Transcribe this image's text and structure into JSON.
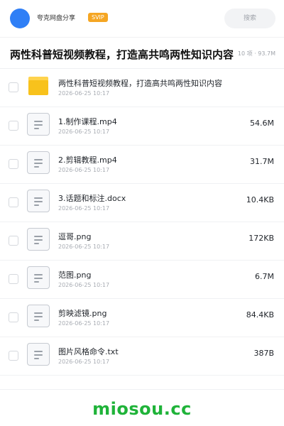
{
  "header": {
    "app_name": "夸克网盘分享",
    "badge": "SVIP",
    "search_placeholder": "搜索"
  },
  "share": {
    "title": "两性科普短视频教程，打造高共鸣两性知识内容",
    "meta": "10 项 · 93.7M"
  },
  "files": [
    {
      "icon": "folder-icon",
      "name": "两性科普短视频教程，打造高共鸣两性知识内容",
      "date": "2026-06-25 10:17",
      "size": ""
    },
    {
      "icon": "file-icon",
      "name": "1.制作课程.mp4",
      "date": "2026-06-25 10:17",
      "size": "54.6M"
    },
    {
      "icon": "file-icon",
      "name": "2.剪辑教程.mp4",
      "date": "2026-06-25 10:17",
      "size": "31.7M"
    },
    {
      "icon": "file-icon",
      "name": "3.话题和标注.docx",
      "date": "2026-06-25 10:17",
      "size": "10.4KB"
    },
    {
      "icon": "file-icon",
      "name": "逗哥.png",
      "date": "2026-06-25 10:17",
      "size": "172KB"
    },
    {
      "icon": "file-icon",
      "name": "范图.png",
      "date": "2026-06-25 10:17",
      "size": "6.7M"
    },
    {
      "icon": "file-icon",
      "name": "剪映滤镜.png",
      "date": "2026-06-25 10:17",
      "size": "84.4KB"
    },
    {
      "icon": "file-icon",
      "name": "图片风格命令.txt",
      "date": "2026-06-25 10:17",
      "size": "387B"
    }
  ],
  "footer": {
    "watermark": "miosou.cc"
  },
  "colors": {
    "avatar": "#2f7ff6",
    "badge": "#f5a623",
    "folder": "#f8c21c",
    "watermark": "#1fb339"
  }
}
